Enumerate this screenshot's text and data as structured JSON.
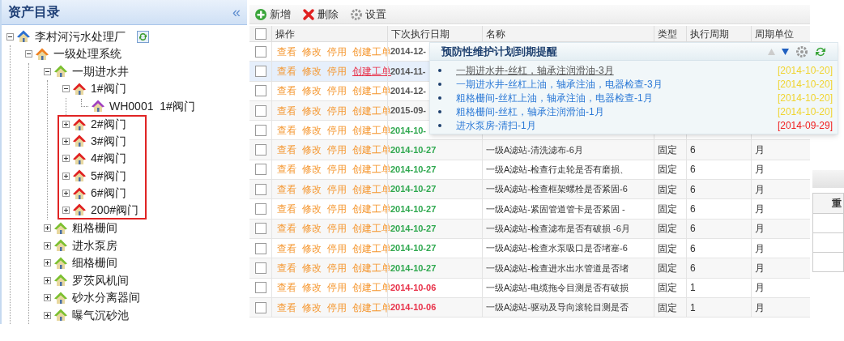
{
  "asset_panel": {
    "title": "资产目录",
    "collapse": "«",
    "tree": [
      {
        "label": "李村河污水处理厂",
        "color": "#2a6fd0",
        "expanded": true,
        "refresh": true,
        "children": [
          {
            "label": "一级处理系统",
            "color": "#f08020",
            "expanded": true,
            "children": [
              {
                "label": "一期进水井",
                "color": "#7cc030",
                "expanded": true,
                "children": [
                  {
                    "label": "1#阀门",
                    "color": "#e02020",
                    "expanded": true,
                    "highlighted": false,
                    "children": [
                      {
                        "label": "WH0001  1#阀门",
                        "color": "#a040c0",
                        "highlighted": false
                      }
                    ]
                  },
                  {
                    "label": "2#阀门",
                    "color": "#e02020",
                    "expanded": false,
                    "highlighted": true
                  },
                  {
                    "label": "3#阀门",
                    "color": "#e02020",
                    "expanded": false,
                    "highlighted": true
                  },
                  {
                    "label": "4#阀门",
                    "color": "#e02020",
                    "expanded": false,
                    "highlighted": true
                  },
                  {
                    "label": "5#阀门",
                    "color": "#e02020",
                    "expanded": false,
                    "highlighted": true
                  },
                  {
                    "label": "6#阀门",
                    "color": "#e02020",
                    "expanded": false,
                    "highlighted": true
                  },
                  {
                    "label": "200#阀门",
                    "color": "#e02020",
                    "expanded": false,
                    "highlighted": true
                  }
                ]
              },
              {
                "label": "粗格栅间",
                "color": "#7cc030",
                "expanded": false
              },
              {
                "label": "进水泵房",
                "color": "#7cc030",
                "expanded": false
              },
              {
                "label": "细格栅间",
                "color": "#7cc030",
                "expanded": false
              },
              {
                "label": "罗茨风机间",
                "color": "#7cc030",
                "expanded": false
              },
              {
                "label": "砂水分离器间",
                "color": "#7cc030",
                "expanded": false
              },
              {
                "label": "曝气沉砂池",
                "color": "#7cc030",
                "expanded": false
              }
            ]
          }
        ]
      }
    ]
  },
  "toolbar": [
    {
      "label": "新增",
      "kind": "add"
    },
    {
      "label": "删除",
      "kind": "delete"
    },
    {
      "label": "设置",
      "kind": "settings"
    }
  ],
  "table": {
    "header_checked": false,
    "columns": [
      "操作",
      "下次执行日期",
      "名称",
      "类型",
      "执行周期",
      "周期单位"
    ],
    "rows": [
      {
        "checked": false,
        "hovered": false,
        "actions": [
          {
            "label": "查看",
            "active": false
          },
          {
            "label": "修改",
            "active": false
          },
          {
            "label": "停用",
            "active": false
          },
          {
            "label": "创建工单",
            "active": false
          }
        ],
        "date": "2014-12-",
        "color": "#555555"
      },
      {
        "checked": false,
        "hovered": true,
        "actions": [
          {
            "label": "查看",
            "active": false
          },
          {
            "label": "修改",
            "active": false
          },
          {
            "label": "停用",
            "active": false
          },
          {
            "label": "创建工单",
            "active": true
          }
        ],
        "date": "2014-11-",
        "color": "#555555"
      },
      {
        "checked": false,
        "hovered": false,
        "actions": [
          {
            "label": "查看",
            "active": false
          },
          {
            "label": "修改",
            "active": false
          },
          {
            "label": "停用",
            "active": false
          },
          {
            "label": "创建工单",
            "active": false
          }
        ],
        "date": "2014-12-",
        "color": "#555555"
      },
      {
        "checked": false,
        "hovered": false,
        "actions": [
          {
            "label": "查看",
            "active": false
          },
          {
            "label": "修改",
            "active": false
          },
          {
            "label": "停用",
            "active": false
          },
          {
            "label": "创建工单",
            "active": false
          }
        ],
        "date": "2015-09-",
        "color": "#555555"
      },
      {
        "checked": false,
        "hovered": false,
        "actions": [
          {
            "label": "查看",
            "active": false
          },
          {
            "label": "修改",
            "active": false
          },
          {
            "label": "停用",
            "active": false
          },
          {
            "label": "创建工单",
            "active": false
          }
        ],
        "date": "2014-10-",
        "color": "#2fa84f"
      },
      {
        "checked": false,
        "hovered": false,
        "actions": [
          {
            "label": "查看",
            "active": false
          },
          {
            "label": "修改",
            "active": false
          },
          {
            "label": "停用",
            "active": false
          },
          {
            "label": "创建工单",
            "active": false
          }
        ],
        "date": "2014-10-27",
        "color": "#2fa84f",
        "name": "一级A滤站-清洗滤布-6月",
        "type": "固定",
        "period": "6",
        "unit": "月"
      },
      {
        "checked": false,
        "hovered": false,
        "actions": [
          {
            "label": "查看",
            "active": false
          },
          {
            "label": "修改",
            "active": false
          },
          {
            "label": "停用",
            "active": false
          },
          {
            "label": "创建工单",
            "active": false
          }
        ],
        "date": "2014-10-27",
        "color": "#2fa84f",
        "name": "一级A滤站-检查行走轮是否有磨损、",
        "type": "固定",
        "period": "6",
        "unit": "月"
      },
      {
        "checked": false,
        "hovered": false,
        "actions": [
          {
            "label": "查看",
            "active": false
          },
          {
            "label": "修改",
            "active": false
          },
          {
            "label": "停用",
            "active": false
          },
          {
            "label": "创建工单",
            "active": false
          }
        ],
        "date": "2014-10-27",
        "color": "#2fa84f",
        "name": "一级A滤站-检查框架螺栓是否紧固-6",
        "type": "固定",
        "period": "6",
        "unit": "月"
      },
      {
        "checked": false,
        "hovered": false,
        "actions": [
          {
            "label": "查看",
            "active": false
          },
          {
            "label": "修改",
            "active": false
          },
          {
            "label": "停用",
            "active": false
          },
          {
            "label": "创建工单",
            "active": false
          }
        ],
        "date": "2014-10-27",
        "color": "#2fa84f",
        "name": "一级A滤站-紧固管道管卡是否紧固 -",
        "type": "固定",
        "period": "6",
        "unit": "月"
      },
      {
        "checked": false,
        "hovered": false,
        "actions": [
          {
            "label": "查看",
            "active": false
          },
          {
            "label": "修改",
            "active": false
          },
          {
            "label": "停用",
            "active": false
          },
          {
            "label": "创建工单",
            "active": false
          }
        ],
        "date": "2014-10-27",
        "color": "#2fa84f",
        "name": "一级A滤站-检查滤布是否有破损 -6月",
        "type": "固定",
        "period": "6",
        "unit": "月"
      },
      {
        "checked": false,
        "hovered": false,
        "actions": [
          {
            "label": "查看",
            "active": false
          },
          {
            "label": "修改",
            "active": false
          },
          {
            "label": "停用",
            "active": false
          },
          {
            "label": "创建工单",
            "active": false
          }
        ],
        "date": "2014-10-27",
        "color": "#2fa84f",
        "name": "一级A滤站-检查水泵吸口是否堵塞-6",
        "type": "固定",
        "period": "6",
        "unit": "月"
      },
      {
        "checked": false,
        "hovered": false,
        "actions": [
          {
            "label": "查看",
            "active": false
          },
          {
            "label": "修改",
            "active": false
          },
          {
            "label": "停用",
            "active": false
          },
          {
            "label": "创建工单",
            "active": false
          }
        ],
        "date": "2014-10-27",
        "color": "#2fa84f",
        "name": "一级A滤站-检查进水出水管道是否堵",
        "type": "固定",
        "period": "6",
        "unit": "月"
      },
      {
        "checked": false,
        "hovered": false,
        "actions": [
          {
            "label": "查看",
            "active": false
          },
          {
            "label": "修改",
            "active": false
          },
          {
            "label": "停用",
            "active": false
          },
          {
            "label": "创建工单",
            "active": false
          }
        ],
        "date": "2014-10-06",
        "color": "#e8324a",
        "name": "一级A滤站-电缆拖令目测是否有破损",
        "type": "固定",
        "period": "1",
        "unit": "月"
      },
      {
        "checked": false,
        "hovered": false,
        "actions": [
          {
            "label": "查看",
            "active": false
          },
          {
            "label": "修改",
            "active": false
          },
          {
            "label": "停用",
            "active": false
          },
          {
            "label": "创建工单",
            "active": false
          }
        ],
        "date": "2014-10-06",
        "color": "#e8324a",
        "name": "一级A滤站-驱动及导向滚轮目测是否",
        "type": "固定",
        "period": "1",
        "unit": "月"
      }
    ]
  },
  "reminder": {
    "title": "预防性维护计划到期提醒",
    "items": [
      {
        "text": "一期进水井-丝杠，轴承注润滑油-3月",
        "date": "[2014-10-20]",
        "color": "#f0d430",
        "hovered": true
      },
      {
        "text": "一期进水井-丝杠上油，轴承注油，电器检查-3月",
        "date": "[2014-10-20]",
        "color": "#f0d430",
        "hovered": false
      },
      {
        "text": "粗格栅间-丝杠上油，轴承注油，电器检查-1月",
        "date": "[2014-10-20]",
        "color": "#f0d430",
        "hovered": false
      },
      {
        "text": "粗格栅间-丝杠，轴承注润滑油-1月",
        "date": "[2014-10-20]",
        "color": "#f0d430",
        "hovered": false
      },
      {
        "text": "进水泵房-清扫-1月",
        "date": "[2014-09-29]",
        "color": "#f02020",
        "hovered": false
      }
    ]
  },
  "side_panel": {
    "column_1": "重"
  }
}
